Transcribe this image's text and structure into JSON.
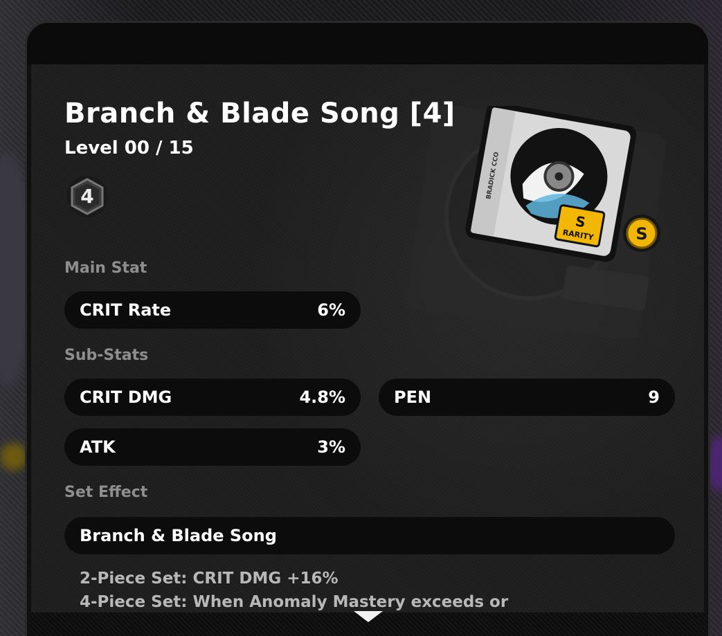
{
  "disc": {
    "title": "Branch & Blade Song [4]",
    "level": "Level 00 / 15",
    "slot": "4",
    "rank": "S",
    "card_rarity_text": "RARITY",
    "card_label": "BRADICK CCO"
  },
  "main_stat": {
    "label": "Main Stat",
    "name": "CRIT Rate",
    "value": "6%"
  },
  "sub_stats": {
    "label": "Sub-Stats",
    "items": [
      {
        "name": "CRIT DMG",
        "value": "4.8%"
      },
      {
        "name": "PEN",
        "value": "9"
      },
      {
        "name": "ATK",
        "value": "3%"
      }
    ]
  },
  "set_effect": {
    "label": "Set Effect",
    "name": "Branch & Blade Song",
    "lines": [
      "2-Piece Set: CRIT DMG +16%",
      "4-Piece Set: When Anomaly Mastery exceeds or"
    ]
  },
  "colors": {
    "rank_gold": "#f2b705",
    "label_gray": "#8e8e8e",
    "pill_bg": "#0c0c0c"
  },
  "icons": {
    "slot_badge": "hexagon-badge-icon",
    "rank_badge": "s-rank-icon",
    "scroll": "chevron-down-icon"
  }
}
